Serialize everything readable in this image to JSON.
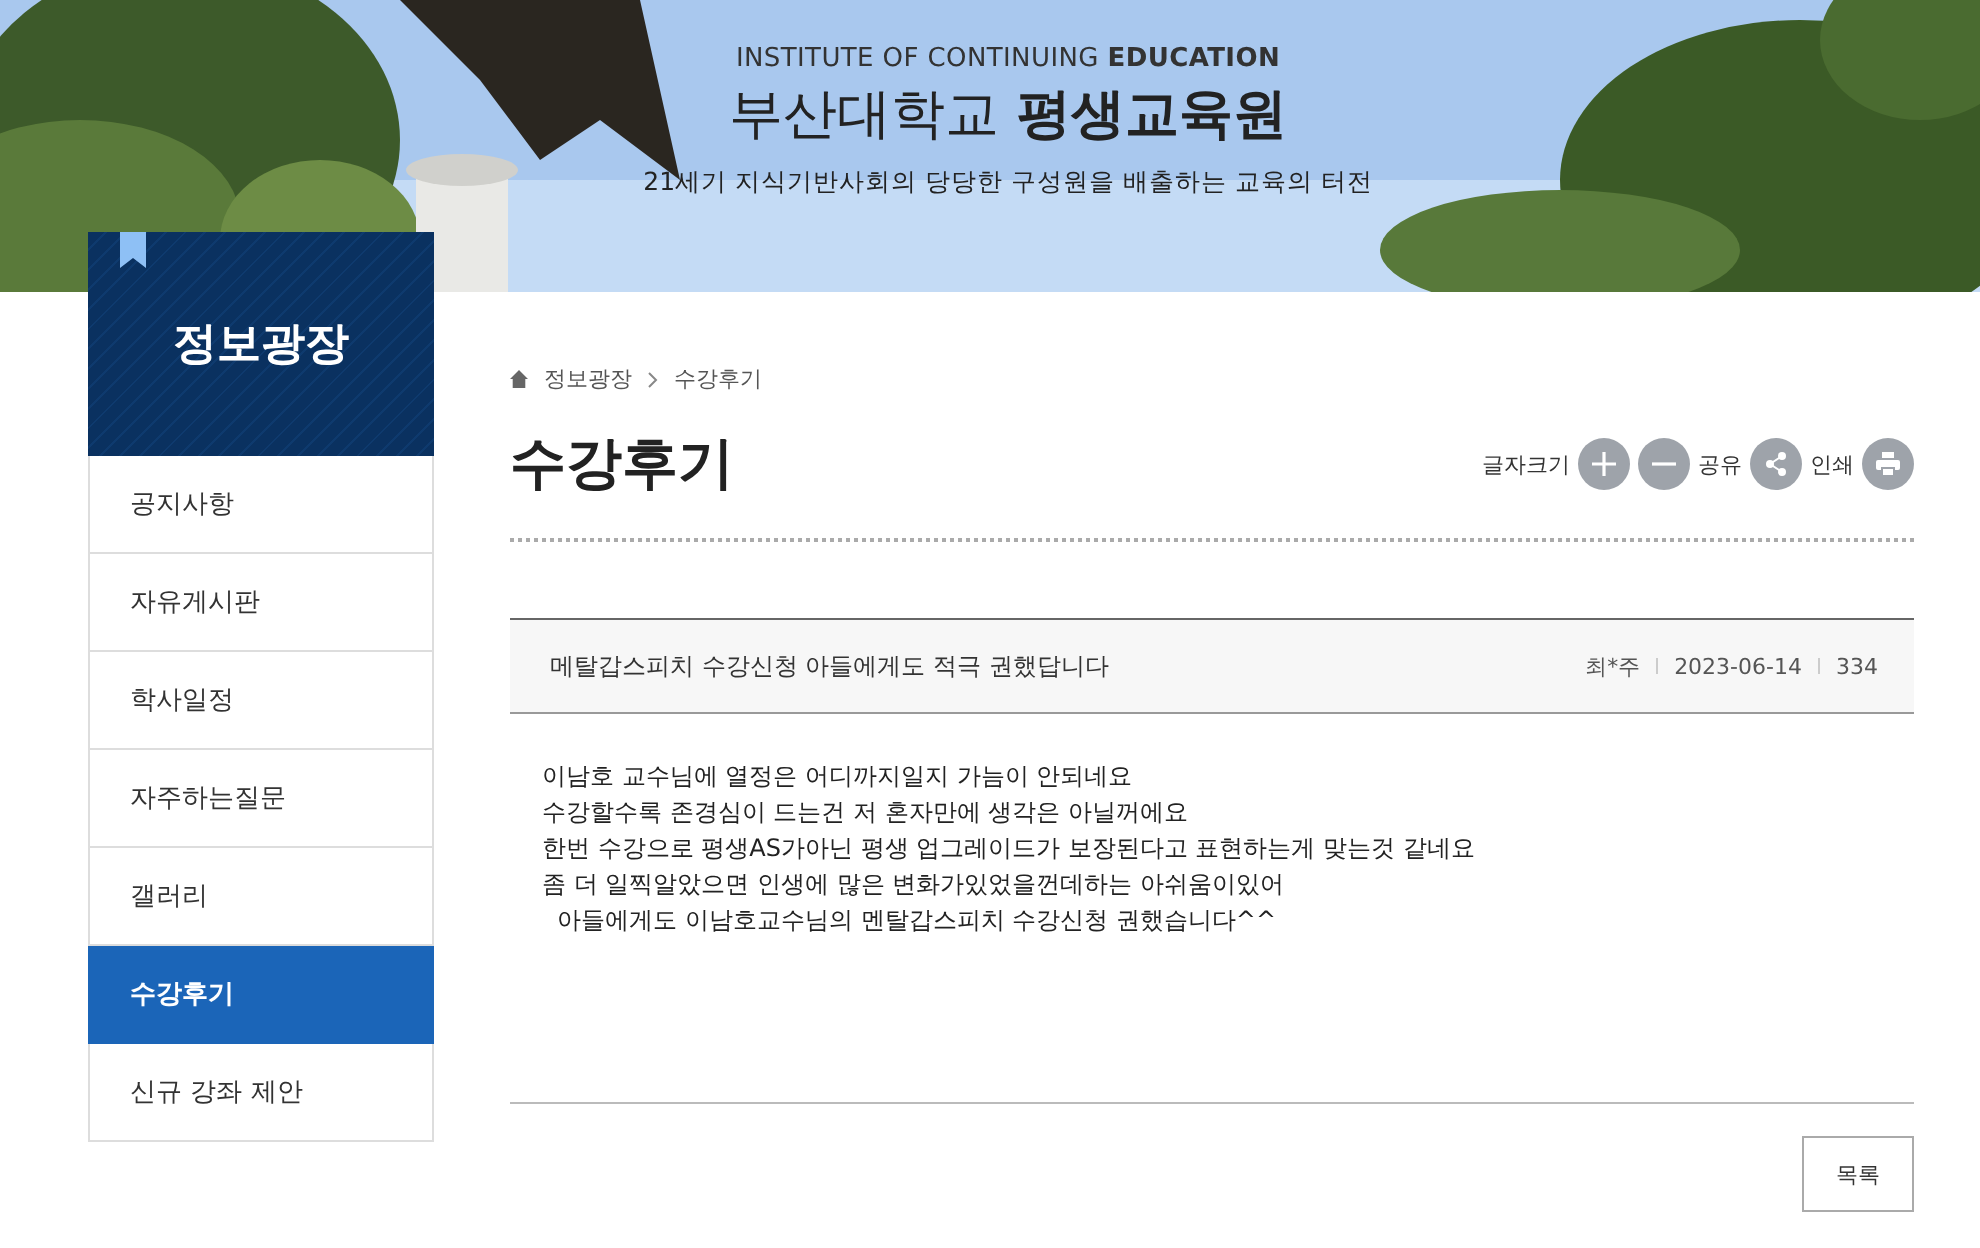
{
  "banner": {
    "subtitle": "INSTITUTE OF CONTINUING",
    "subtitle_bold": "EDUCATION",
    "title": "부산대학교",
    "title_bold": "평생교육원",
    "slogan": "21세기 지식기반사회의 당당한 구성원을 배출하는 교육의 터전"
  },
  "sidebar": {
    "title": "정보광장",
    "items": [
      {
        "label": "공지사항",
        "selected": false
      },
      {
        "label": "자유게시판",
        "selected": false
      },
      {
        "label": "학사일정",
        "selected": false
      },
      {
        "label": "자주하는질문",
        "selected": false
      },
      {
        "label": "갤러리",
        "selected": false
      },
      {
        "label": "수강후기",
        "selected": true
      },
      {
        "label": "신규 강좌 제안",
        "selected": false
      }
    ]
  },
  "breadcrumb": [
    "정보광장",
    "수강후기"
  ],
  "page_title": "수강후기",
  "tools": {
    "font_size_label": "글자크기",
    "share_label": "공유",
    "print_label": "인쇄"
  },
  "post": {
    "title": "메탈갑스피치 수강신청 아들에게도 적극 권했답니다",
    "author": "최*주",
    "date": "2023-06-14",
    "views": "334",
    "body": [
      "이남호 교수님에 열정은 어디까지일지 가늠이 안되네요",
      "수강할수록 존경심이 드는건 저 혼자만에 생각은 아닐꺼에요",
      "한번 수강으로 평생AS가아닌 평생 업그레이드가 보장된다고 표현하는게 맞는것 같네요",
      "좀 더 일찍알았으면 인생에 많은 변화가있었을껀데하는 아쉬움이있어",
      "  아들에게도 이남호교수님의 멘탈갑스피치 수강신청 권했습니다^^"
    ]
  },
  "list_button": "목록"
}
